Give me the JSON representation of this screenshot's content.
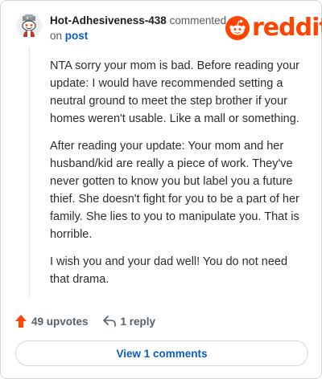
{
  "header": {
    "username": "Hot-Adhesiveness-438",
    "action_text": "commented",
    "on_text": "on",
    "post_link": "post"
  },
  "logo": {
    "wordmark": "reddit",
    "icon": "reddit-alien-icon",
    "color": "#ff4500"
  },
  "comment": {
    "paragraphs": [
      "NTA sorry your mom is bad. Before reading your update: I would have recommended setting a neutral ground to meet the step brother if your homes weren't usable. Like a mall or something.",
      "After reading your update: Your mom and her husband/kid are really a piece of work. They've never gotten to know you but label you a future thief. She doesn't fight for you to be a part of her family. She lies to you to manipulate you. That is horrible.",
      "I wish you and your dad well! You do not need that drama."
    ]
  },
  "actions": {
    "upvotes_label": "49 upvotes",
    "reply_label": "1 reply",
    "upvote_icon": "upvote-arrow-icon",
    "reply_icon": "reply-arrow-icon",
    "upvote_color": "#ff4500"
  },
  "view_button": {
    "label": "View 1 comments",
    "color": "#0b5dc2"
  }
}
